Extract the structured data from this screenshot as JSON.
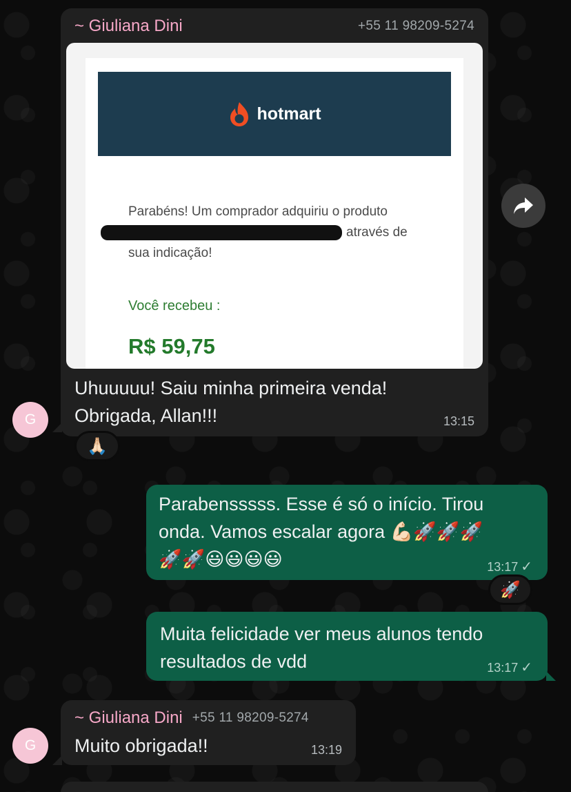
{
  "message1": {
    "sender_name": "~ Giuliana Dini",
    "sender_phone": "+55 11 98209-5274",
    "email": {
      "brand": "hotmart",
      "line1": "Parabéns! Um comprador adquiriu o produto",
      "line2_suffix": "através de",
      "line3": "sua indicação!",
      "received_label": "Você recebeu :",
      "amount": "R$ 59,75"
    },
    "text_line1": "Uhuuuuu! Saiu minha primeira venda!",
    "text_line2": "Obrigada, Allan!!!",
    "time": "13:15",
    "reaction": "🙏🏻",
    "avatar_letter": "G"
  },
  "message2": {
    "text_line1": "Parabensssss. Esse é só o início. Tirou",
    "text_line2": "onda. Vamos escalar agora 💪🏻🚀🚀🚀",
    "text_line3": "🚀🚀😃😃😃😃",
    "time": "13:17",
    "status": "✓",
    "reaction": "🚀"
  },
  "message3": {
    "text_line1": "Muita felicidade ver meus alunos tendo",
    "text_line2": "resultados de vdd",
    "time": "13:17",
    "status": "✓"
  },
  "message4": {
    "sender_name": "~ Giuliana Dini",
    "sender_phone": "+55 11 98209-5274",
    "text": "Muito obrigada!!",
    "time": "13:19",
    "avatar_letter": "G"
  },
  "colors": {
    "incoming_bubble": "#202020",
    "outgoing_bubble": "#0d5f46",
    "sender_name": "#f7a8c8",
    "hotmart_banner": "#1d3c4f",
    "hotmart_flame": "#f04e23",
    "amount_green": "#237a2b"
  },
  "icons": {
    "forward": "forward-arrow-icon",
    "read_status": "check-icon"
  }
}
